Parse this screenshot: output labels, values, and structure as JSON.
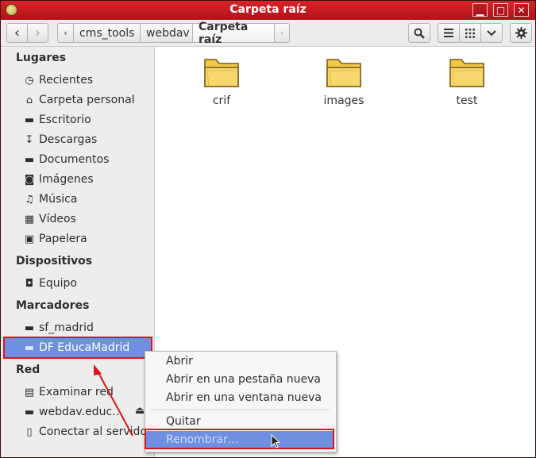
{
  "window": {
    "title": "Carpeta raíz"
  },
  "titlebar_buttons": {
    "minimize": "▁",
    "maximize": "□",
    "close": "✕"
  },
  "toolbar": {
    "back_glyph": "‹",
    "forward_glyph": "›",
    "path_left_glyph": "‹",
    "path_right_glyph": "›",
    "path": [
      "cms_tools",
      "webdav",
      "Carpeta raíz"
    ],
    "search_icon": "search-icon",
    "view_list_icon": "list-view-icon",
    "view_grid_icon": "grid-view-icon",
    "view_menu_glyph": "⌄",
    "settings_icon": "gear-icon"
  },
  "sidebar": {
    "places_header": "Lugares",
    "places": [
      {
        "label": "Recientes",
        "icon": "clock-icon",
        "glyph": "◷"
      },
      {
        "label": "Carpeta personal",
        "icon": "home-icon",
        "glyph": "⌂"
      },
      {
        "label": "Escritorio",
        "icon": "folder-icon",
        "glyph": "▬"
      },
      {
        "label": "Descargas",
        "icon": "download-icon",
        "glyph": "↧"
      },
      {
        "label": "Documentos",
        "icon": "folder-icon",
        "glyph": "▬"
      },
      {
        "label": "Imágenes",
        "icon": "camera-icon",
        "glyph": "◙"
      },
      {
        "label": "Música",
        "icon": "music-icon",
        "glyph": "♫"
      },
      {
        "label": "Vídeos",
        "icon": "film-icon",
        "glyph": "▦"
      },
      {
        "label": "Papelera",
        "icon": "trash-icon",
        "glyph": "▣"
      }
    ],
    "devices_header": "Dispositivos",
    "devices": [
      {
        "label": "Equipo",
        "icon": "drive-icon",
        "glyph": "◘"
      }
    ],
    "bookmarks_header": "Marcadores",
    "bookmarks": [
      {
        "label": "sf_madrid",
        "icon": "folder-icon",
        "glyph": "▬"
      },
      {
        "label": "DF EducaMadrid",
        "icon": "folder-icon",
        "glyph": "▬"
      }
    ],
    "network_header": "Red",
    "network": [
      {
        "label": "Examinar red",
        "icon": "network-icon",
        "glyph": "▤"
      },
      {
        "label": "webdav.educ…",
        "icon": "folder-icon",
        "glyph": "▬"
      },
      {
        "label": "Conectar al servidor",
        "icon": "server-icon",
        "glyph": "▯"
      }
    ],
    "eject_glyph": "⏏"
  },
  "files": [
    {
      "name": "crif"
    },
    {
      "name": "images"
    },
    {
      "name": "test"
    }
  ],
  "context_menu": {
    "items": [
      "Abrir",
      "Abrir en una pestaña nueva",
      "Abrir en una ventana nueva",
      "Quitar",
      "Renombrar…"
    ],
    "highlighted": "Renombrar…"
  },
  "annotation_color": "#e0141c",
  "accent_color": "#6f8fe0"
}
